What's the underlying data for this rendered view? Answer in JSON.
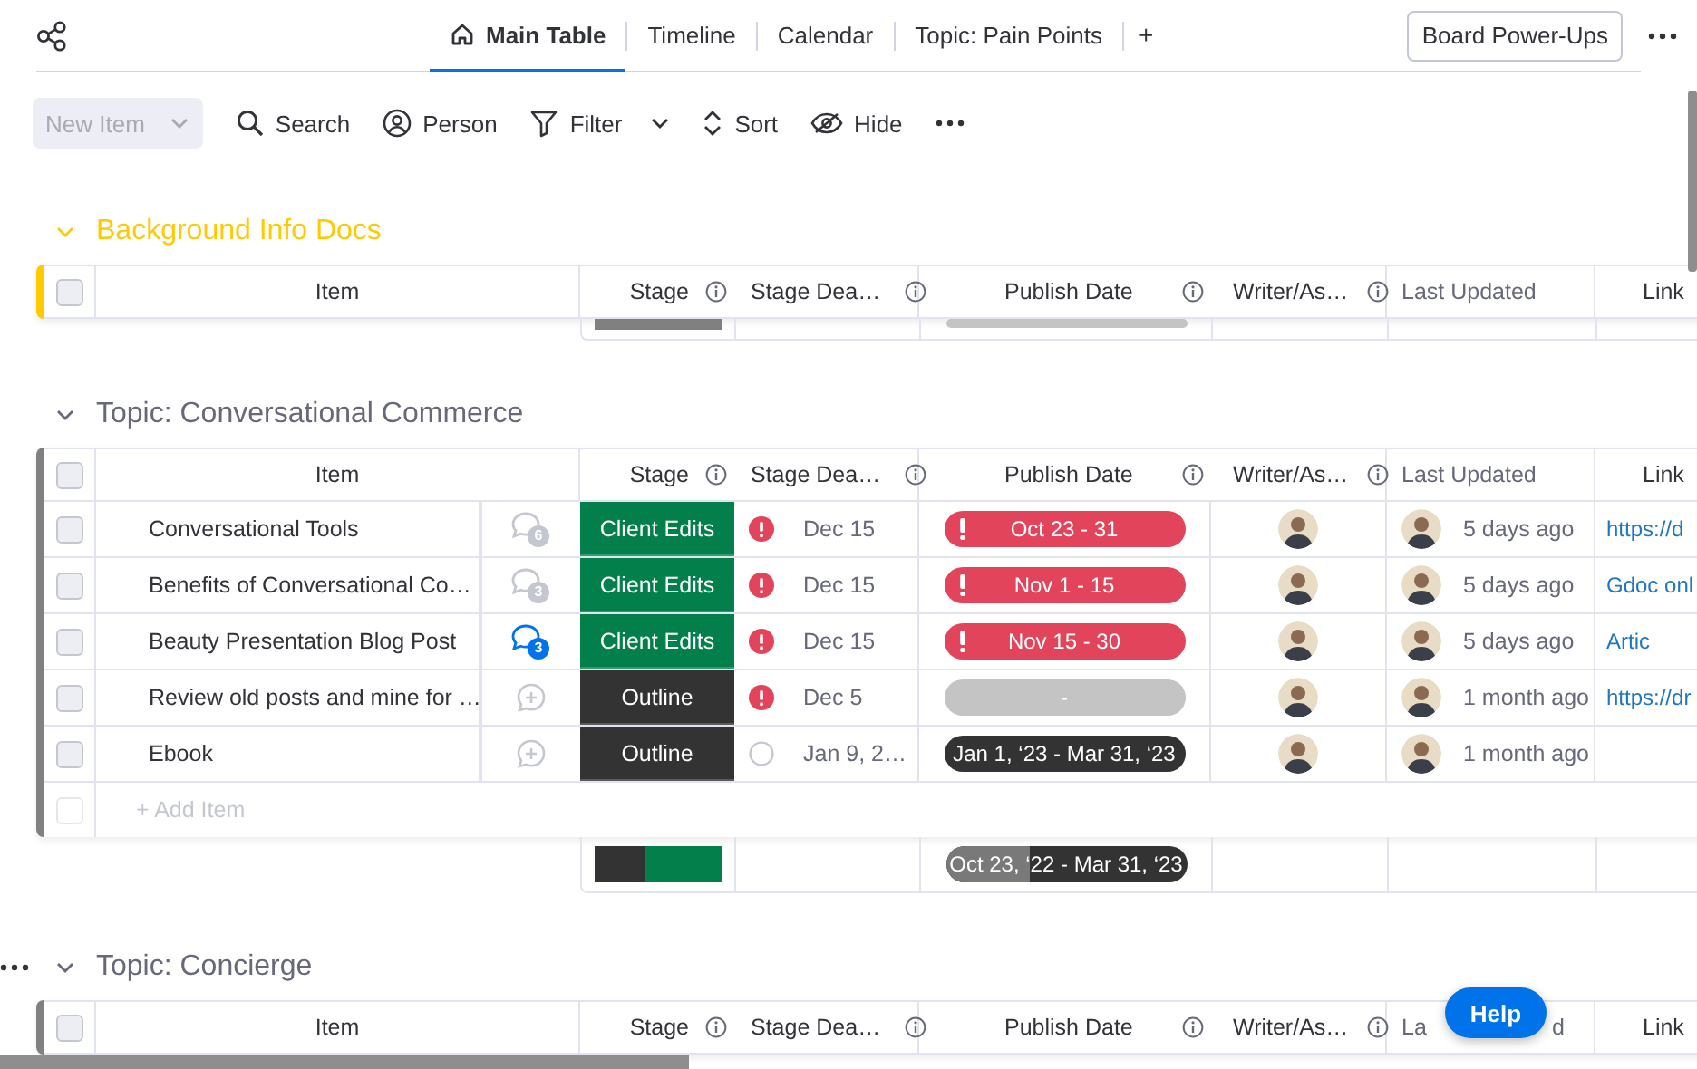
{
  "top_bar": {
    "tabs": [
      {
        "label": "Main Table",
        "selected": true,
        "kind": "home"
      },
      {
        "label": "Timeline",
        "selected": false
      },
      {
        "label": "Calendar",
        "selected": false
      },
      {
        "label": "Topic: Pain Points",
        "selected": false
      }
    ],
    "add_tab": "+",
    "power_ups": "Board Power-Ups"
  },
  "toolbar": {
    "new_item": {
      "label": "New Item",
      "disabled": true
    },
    "tools": [
      {
        "label": "Search",
        "kind": "search"
      },
      {
        "label": "Person",
        "kind": "person"
      },
      {
        "label": "Filter",
        "kind": "filter",
        "dropdown": true
      },
      {
        "label": "Sort",
        "kind": "sort"
      },
      {
        "label": "Hide",
        "kind": "hide"
      }
    ]
  },
  "groups": [
    {
      "title": "Background Info Docs",
      "color": "#ffcb00",
      "all_checked": false,
      "columns": [
        {
          "label": "Item",
          "info": false
        },
        {
          "label": "Stage",
          "info": true
        },
        {
          "label": "Stage Dea…",
          "info": true
        },
        {
          "label": "Publish Date",
          "info": true
        },
        {
          "label": "Writer/As…",
          "info": true
        },
        {
          "label": "Last Updated",
          "info": false
        },
        {
          "label": "Link",
          "info": false
        }
      ],
      "summary": {
        "stage": [
          {
            "color": "#808080",
            "level": 1
          }
        ],
        "publish": {
          "level": 0
        }
      }
    },
    {
      "title": "Topic: Conversational Commerce",
      "color": "#808080",
      "all_checked": false,
      "columns": [
        {
          "label": "Item",
          "info": false
        },
        {
          "label": "Stage",
          "info": true
        },
        {
          "label": "Stage Dea…",
          "info": true
        },
        {
          "label": "Publish Date",
          "info": true
        },
        {
          "label": "Writer/As…",
          "info": true
        },
        {
          "label": "Last Updated",
          "info": false
        },
        {
          "label": "Link",
          "info": false
        }
      ],
      "rows": [
        {
          "name": "Conversational Tools",
          "checked": false,
          "comments": {
            "kind": "count",
            "count": "6",
            "unread": false
          },
          "stage": {
            "label": "Client Edits",
            "color": "#037f4c"
          },
          "deadline": {
            "overdue": true,
            "date": "Dec 15"
          },
          "publish": {
            "overdue": true,
            "color": "#e2445c",
            "label": "Oct 23 - 31"
          },
          "last_updated": "5 days ago",
          "link": "https://d"
        },
        {
          "name": "Benefits of Conversational Co…",
          "checked": false,
          "comments": {
            "kind": "count",
            "count": "3",
            "unread": false
          },
          "stage": {
            "label": "Client Edits",
            "color": "#037f4c"
          },
          "deadline": {
            "overdue": true,
            "date": "Dec 15"
          },
          "publish": {
            "overdue": true,
            "color": "#e2445c",
            "label": "Nov 1 - 15"
          },
          "last_updated": "5 days ago",
          "link": "Gdoc onl"
        },
        {
          "name": "Beauty Presentation Blog Post",
          "checked": false,
          "comments": {
            "kind": "count",
            "count": "3",
            "unread": true
          },
          "stage": {
            "label": "Client Edits",
            "color": "#037f4c"
          },
          "deadline": {
            "overdue": true,
            "date": "Dec 15"
          },
          "publish": {
            "overdue": true,
            "color": "#e2445c",
            "label": "Nov 15 - 30"
          },
          "last_updated": "5 days ago",
          "link": "Artic"
        },
        {
          "name": "Review old posts and mine for …",
          "checked": false,
          "comments": {
            "kind": "add"
          },
          "stage": {
            "label": "Outline",
            "color": "#333333"
          },
          "deadline": {
            "overdue": true,
            "date": "Dec 5"
          },
          "publish": {
            "overdue": false,
            "color": "#c4c4c4",
            "label": "-"
          },
          "last_updated": "1 month ago",
          "link": "https://dr"
        },
        {
          "name": "Ebook",
          "checked": false,
          "comments": {
            "kind": "add"
          },
          "stage": {
            "label": "Outline",
            "color": "#333333"
          },
          "deadline": {
            "overdue": false,
            "date": "Jan 9, 2…"
          },
          "publish": {
            "overdue": false,
            "color": "#333333",
            "label": "Jan 1, ‘23 - Mar 31, ‘23"
          },
          "last_updated": "1 month ago"
        }
      ],
      "add_item": "+ Add Item",
      "summary": {
        "stage": [
          {
            "color": "#333333",
            "level": 0.4
          },
          {
            "color": "#037f4c",
            "level": 0.6
          }
        ],
        "publish": {
          "label": "Oct 23, ‘22 - Mar 31, ‘23",
          "level": 0.35
        }
      }
    },
    {
      "title": "Topic: Concierge",
      "color": "#808080",
      "all_checked": false,
      "columns": [
        {
          "label": "Item",
          "info": false
        },
        {
          "label": "Stage",
          "info": true
        },
        {
          "label": "Stage Dea…",
          "info": true
        },
        {
          "label": "Publish Date",
          "info": true
        },
        {
          "label": "Writer/As…",
          "info": true
        },
        {
          "label": "La",
          "label_end": "d",
          "info": false
        },
        {
          "label": "Link",
          "info": false
        }
      ]
    }
  ],
  "help": "Help"
}
